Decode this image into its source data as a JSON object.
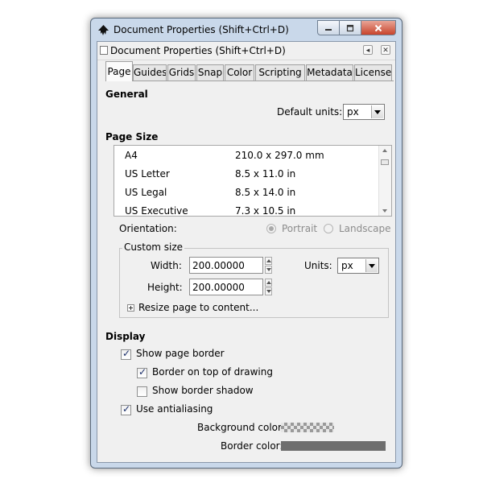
{
  "window": {
    "title": "Document Properties (Shift+Ctrl+D)",
    "minimize_glyph": "—",
    "maximize_glyph": "□",
    "close_glyph": "✕"
  },
  "dock": {
    "title": "Document Properties (Shift+Ctrl+D)",
    "iconify_glyph": "◂",
    "close_glyph": "✕"
  },
  "tabs": [
    "Page",
    "Guides",
    "Grids",
    "Snap",
    "Color",
    "Scripting",
    "Metadata",
    "License"
  ],
  "general": {
    "heading": "General",
    "default_units_label": "Default units:",
    "default_units_value": "px"
  },
  "page_size": {
    "heading": "Page Size",
    "rows": [
      {
        "name": "A4",
        "size": "210.0 x 297.0 mm"
      },
      {
        "name": "US Letter",
        "size": "8.5 x 11.0 in"
      },
      {
        "name": "US Legal",
        "size": "8.5 x 14.0 in"
      },
      {
        "name": "US Executive",
        "size": "7.3 x 10.5 in"
      }
    ],
    "orientation_label": "Orientation:",
    "portrait_label": "Portrait",
    "landscape_label": "Landscape"
  },
  "custom_size": {
    "legend": "Custom size",
    "width_label": "Width:",
    "width_value": "200.00000",
    "height_label": "Height:",
    "height_value": "200.00000",
    "units_label": "Units:",
    "units_value": "px",
    "resize_label": "Resize page to content..."
  },
  "display": {
    "heading": "Display",
    "show_page_border_label": "Show page border",
    "border_on_top_label": "Border on top of drawing",
    "show_border_shadow_label": "Show border shadow",
    "use_antialiasing_label": "Use antialiasing",
    "background_color_label": "Background color:",
    "border_color_label": "Border color:",
    "check_glyph": "✓"
  },
  "colors": {
    "window_frame": "#c9d8ea",
    "client_bg": "#f0f0f0",
    "border_swatch": "#6e6e6e"
  }
}
